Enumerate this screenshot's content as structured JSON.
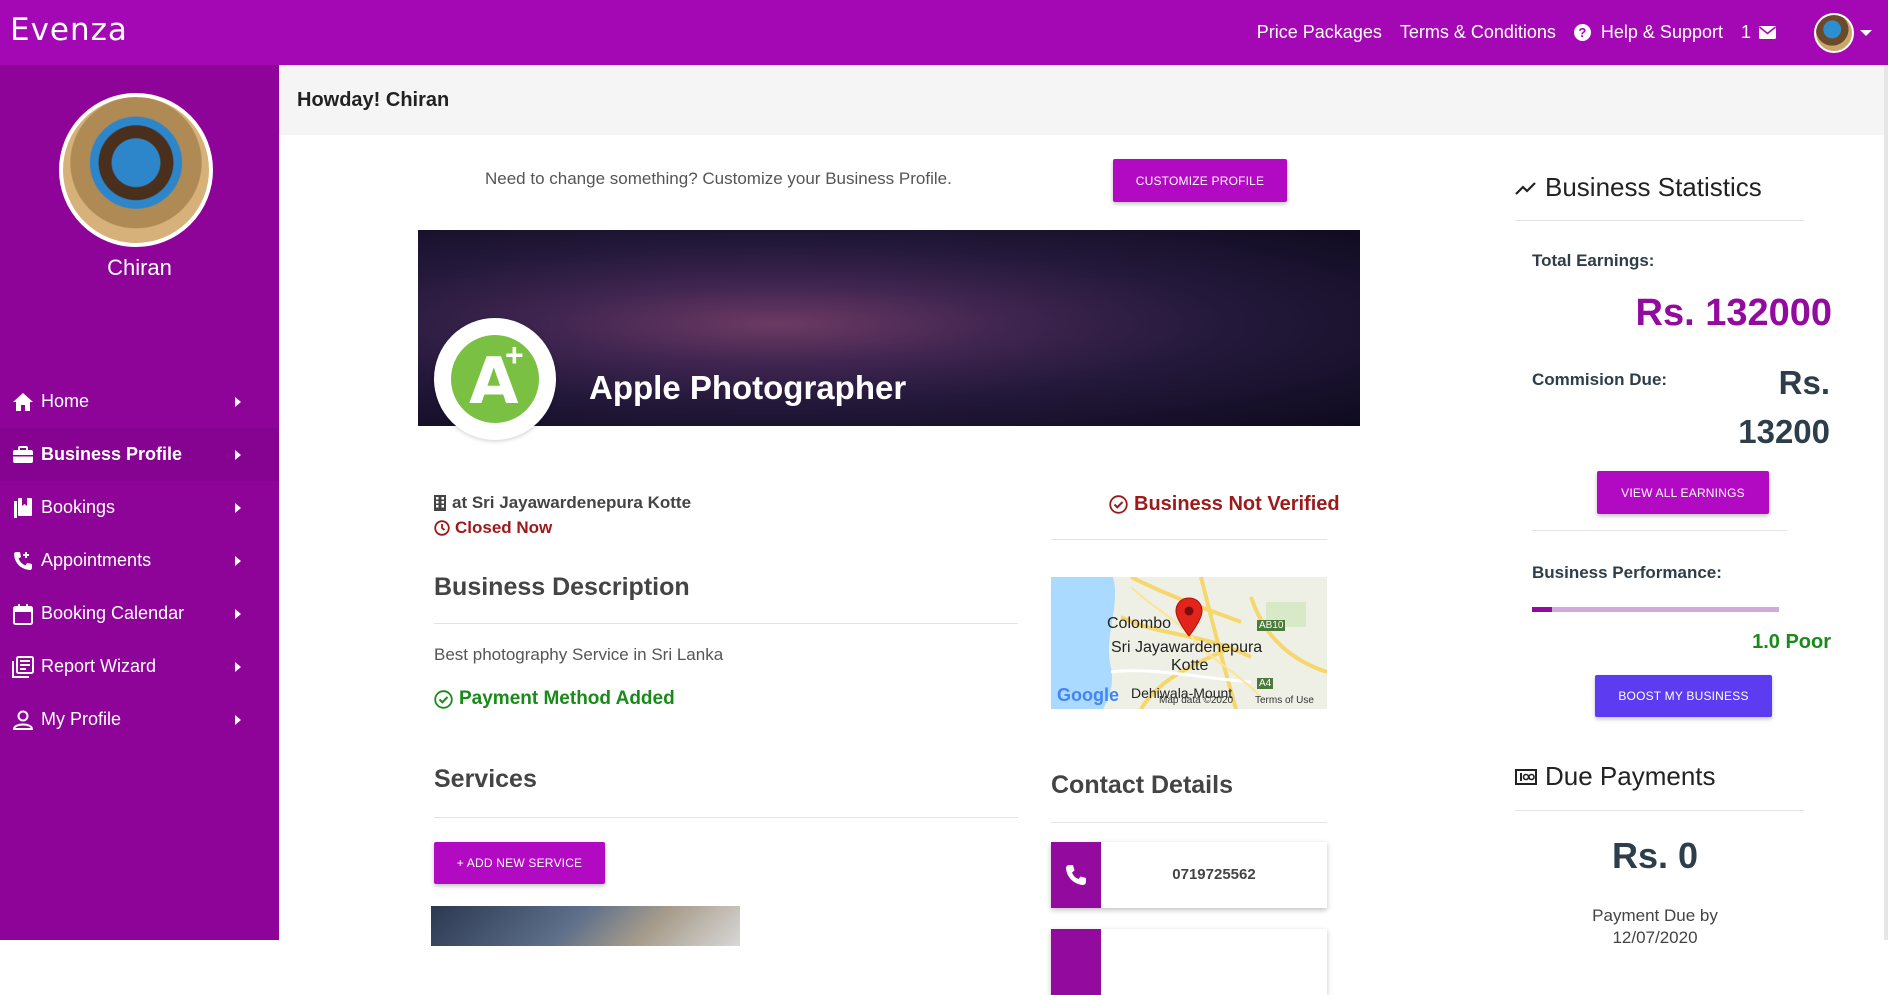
{
  "topbar": {
    "brand": "Evenza",
    "links": {
      "price_packages": "Price Packages",
      "terms": "Terms & Conditions",
      "help": "Help & Support"
    },
    "mail_count": "1",
    "bg_color": "#a408b5"
  },
  "sidebar": {
    "user_name": "Chiran",
    "items": [
      {
        "label": "Home",
        "icon": "home-icon"
      },
      {
        "label": "Business Profile",
        "icon": "briefcase-icon",
        "active": true
      },
      {
        "label": "Bookings",
        "icon": "book-icon"
      },
      {
        "label": "Appointments",
        "icon": "phone-icon"
      },
      {
        "label": "Booking Calendar",
        "icon": "calendar-icon"
      },
      {
        "label": "Report Wizard",
        "icon": "report-icon"
      },
      {
        "label": "My Profile",
        "icon": "person-icon"
      }
    ]
  },
  "main": {
    "greeting": "Howday! Chiran",
    "customize_text": "Need to change something? Customize your Business Profile.",
    "customize_button": "CUSTOMIZE PROFILE",
    "business_name": "Apple Photographer",
    "location": "at Sri Jayawardenepura Kotte",
    "open_status": "Closed Now",
    "verification": "Business Not Verified",
    "description_heading": "Business Description",
    "description": "Best photography Service in Sri Lanka",
    "payment_status": "Payment Method Added",
    "services_heading": "Services",
    "add_service_button": "+ ADD NEW SERVICE",
    "contact_heading": "Contact Details",
    "phone": "0719725562",
    "map": {
      "city_label": "Colombo",
      "area_label_1": "Sri Jayawardenepura",
      "area_label_2": "Kotte",
      "lower_label": "Dehiwala-Mount",
      "road_tag_1": "AB10",
      "road_tag_2": "A4",
      "google": "Google",
      "map_data": "Map data ©2020",
      "terms": "Terms of Use"
    }
  },
  "stats": {
    "title": "Business Statistics",
    "total_earnings_label": "Total Earnings:",
    "total_earnings": "Rs. 132000",
    "commission_label": "Commision Due:",
    "commission_due": "Rs. 13200",
    "view_earnings_button": "VIEW ALL EARNINGS",
    "performance_label": "Business Performance:",
    "performance_value": "1.0 Poor",
    "performance_fraction": 0.08,
    "boost_button": "BOOST MY BUSINESS",
    "due_title": "Due Payments",
    "due_amount": "Rs. 0",
    "due_by_label": "Payment Due by",
    "due_date": "12/07/2020"
  },
  "colors": {
    "accent": "#930a9e",
    "button_purple": "#b20ac2",
    "button_blue": "#5c3bf0",
    "success": "#1a8a1a",
    "danger": "#9c1a1a"
  }
}
